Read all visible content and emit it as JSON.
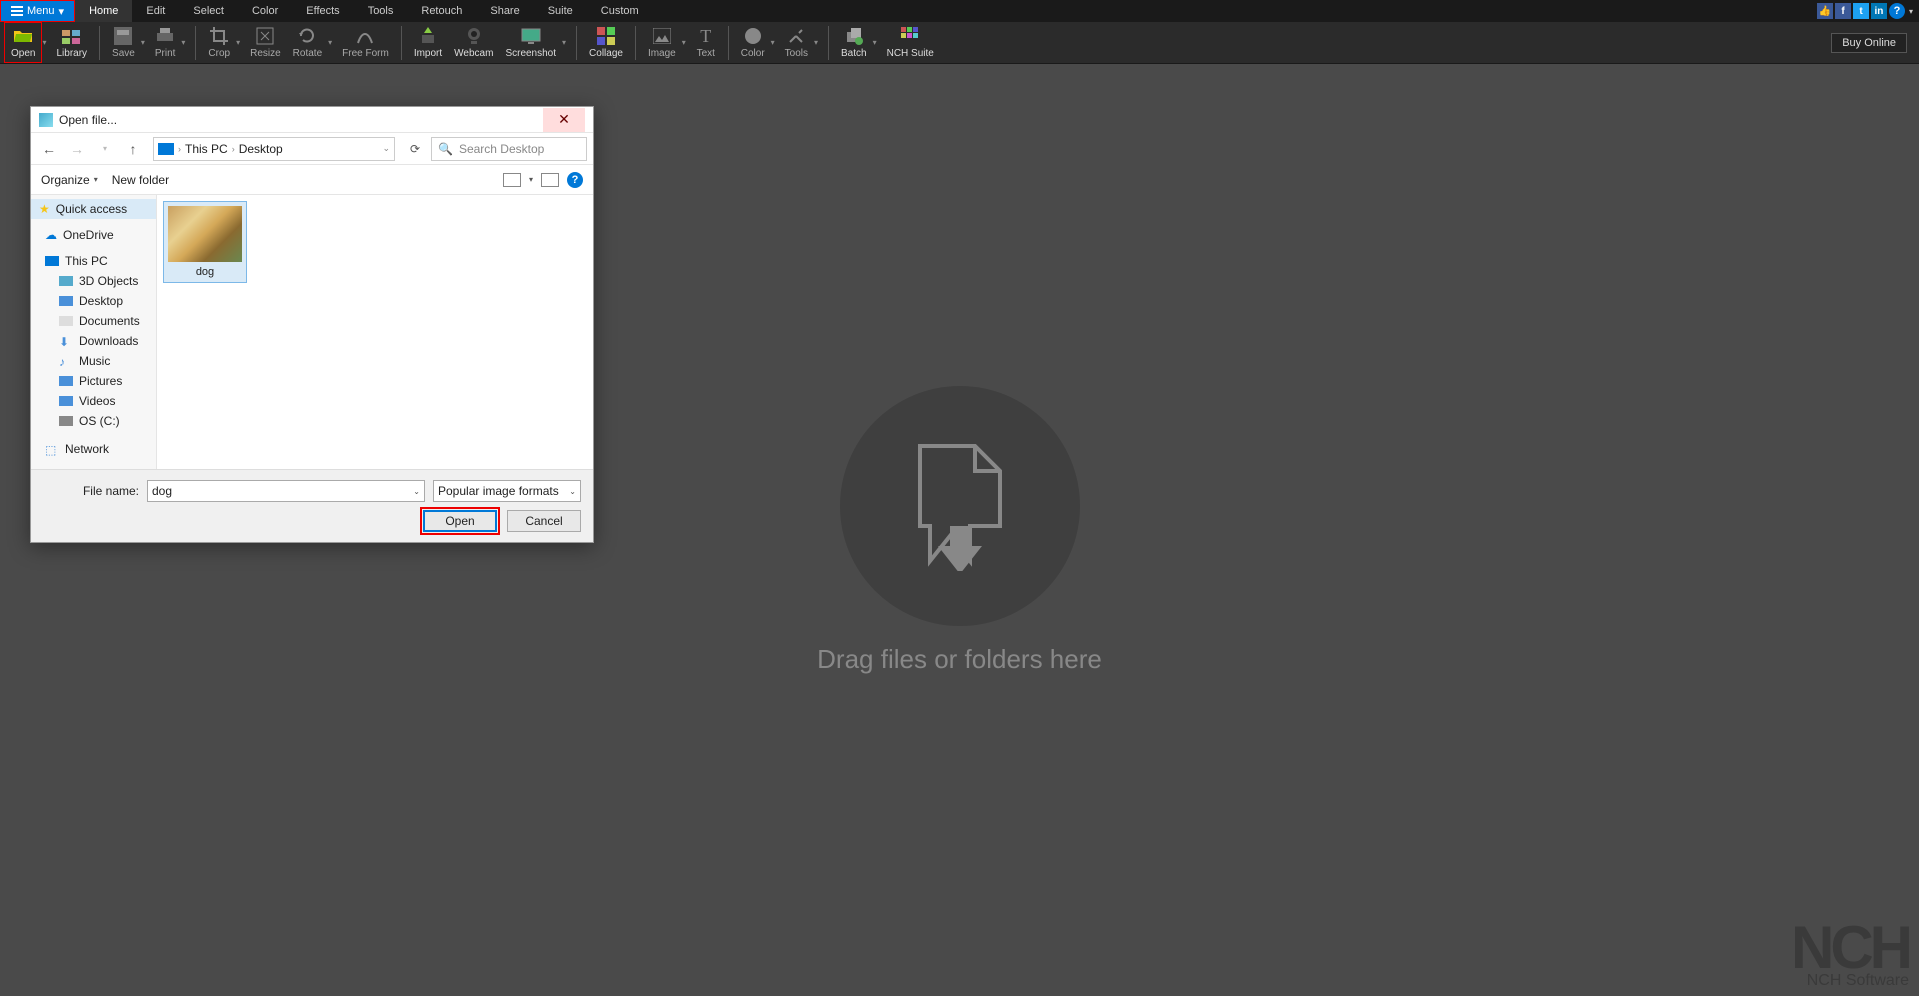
{
  "menubar": {
    "menu_label": "Menu",
    "items": [
      "Home",
      "Edit",
      "Select",
      "Color",
      "Effects",
      "Tools",
      "Retouch",
      "Share",
      "Suite",
      "Custom"
    ],
    "active_index": 0
  },
  "ribbon": {
    "buttons": [
      {
        "label": "Open",
        "enabled": true,
        "highlight": true
      },
      {
        "label": "Library",
        "enabled": true
      },
      {
        "label": "Save",
        "enabled": false
      },
      {
        "label": "Print",
        "enabled": false
      },
      {
        "label": "Crop",
        "enabled": false
      },
      {
        "label": "Resize",
        "enabled": false
      },
      {
        "label": "Rotate",
        "enabled": false
      },
      {
        "label": "Free Form",
        "enabled": false
      },
      {
        "label": "Import",
        "enabled": true
      },
      {
        "label": "Webcam",
        "enabled": true
      },
      {
        "label": "Screenshot",
        "enabled": true
      },
      {
        "label": "Collage",
        "enabled": true
      },
      {
        "label": "Image",
        "enabled": false
      },
      {
        "label": "Text",
        "enabled": false
      },
      {
        "label": "Color",
        "enabled": false
      },
      {
        "label": "Tools",
        "enabled": false
      },
      {
        "label": "Batch",
        "enabled": true
      },
      {
        "label": "NCH Suite",
        "enabled": true
      }
    ],
    "buy_label": "Buy Online"
  },
  "canvas": {
    "drop_text": "Drag files or folders here"
  },
  "watermark": {
    "big": "NCH",
    "small": "NCH Software"
  },
  "dialog": {
    "title": "Open file...",
    "breadcrumb": [
      "This PC",
      "Desktop"
    ],
    "search_placeholder": "Search Desktop",
    "organize_label": "Organize",
    "newfolder_label": "New folder",
    "sidebar": {
      "quick_access": "Quick access",
      "onedrive": "OneDrive",
      "this_pc": "This PC",
      "children": [
        "3D Objects",
        "Desktop",
        "Documents",
        "Downloads",
        "Music",
        "Pictures",
        "Videos",
        "OS (C:)"
      ],
      "network": "Network"
    },
    "files": [
      {
        "name": "dog"
      }
    ],
    "filename_label": "File name:",
    "filename_value": "dog",
    "format_label": "Popular image formats",
    "open_label": "Open",
    "cancel_label": "Cancel"
  }
}
